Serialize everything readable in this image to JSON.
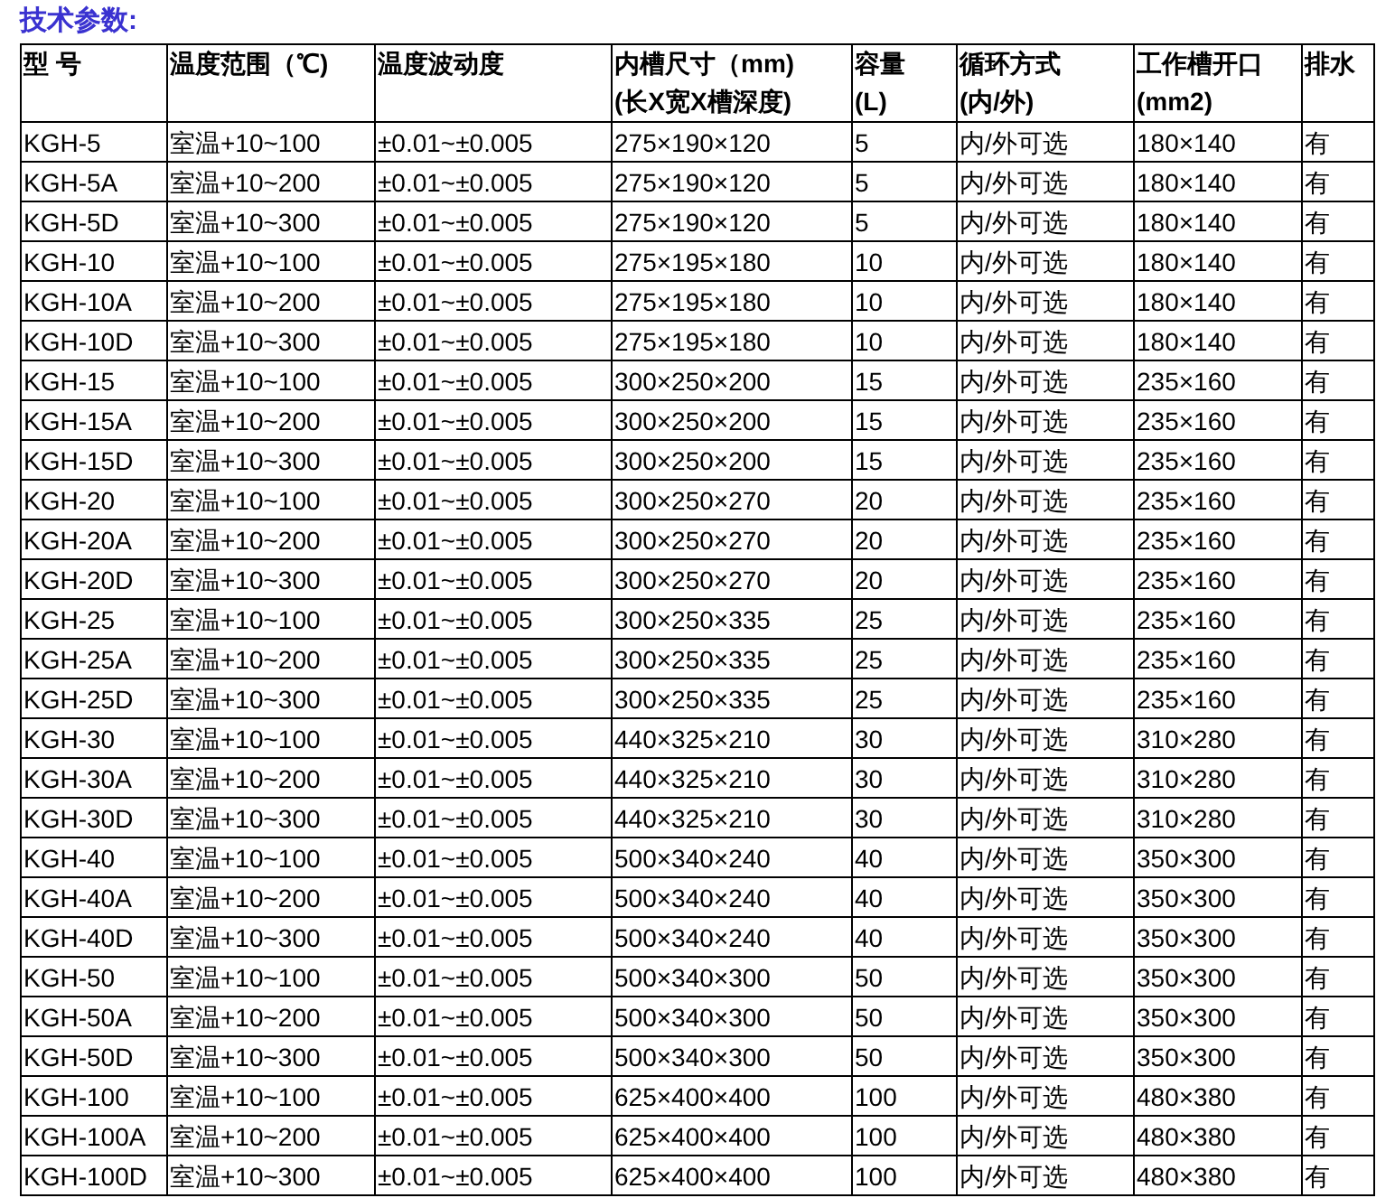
{
  "title": "技术参数:",
  "table": {
    "columns": [
      "型 号",
      "温度范围（℃)",
      "温度波动度",
      "内槽尺寸（mm)\n(长X宽X槽深度)",
      "容量\n(L)",
      "循环方式\n(内/外)",
      "工作槽开口\n(mm2)",
      "排水"
    ],
    "rows": [
      [
        "KGH-5",
        "室温+10~100",
        "±0.01~±0.005",
        "275×190×120",
        "5",
        "内/外可选",
        "180×140",
        "有"
      ],
      [
        "KGH-5A",
        "室温+10~200",
        "±0.01~±0.005",
        "275×190×120",
        "5",
        "内/外可选",
        "180×140",
        "有"
      ],
      [
        "KGH-5D",
        "室温+10~300",
        "±0.01~±0.005",
        "275×190×120",
        "5",
        "内/外可选",
        "180×140",
        "有"
      ],
      [
        "KGH-10",
        "室温+10~100",
        "±0.01~±0.005",
        "275×195×180",
        "10",
        "内/外可选",
        "180×140",
        "有"
      ],
      [
        "KGH-10A",
        "室温+10~200",
        "±0.01~±0.005",
        "275×195×180",
        "10",
        "内/外可选",
        "180×140",
        "有"
      ],
      [
        "KGH-10D",
        "室温+10~300",
        "±0.01~±0.005",
        "275×195×180",
        "10",
        "内/外可选",
        "180×140",
        "有"
      ],
      [
        "KGH-15",
        "室温+10~100",
        "±0.01~±0.005",
        "300×250×200",
        "15",
        "内/外可选",
        "235×160",
        "有"
      ],
      [
        "KGH-15A",
        "室温+10~200",
        "±0.01~±0.005",
        "300×250×200",
        "15",
        "内/外可选",
        "235×160",
        "有"
      ],
      [
        "KGH-15D",
        "室温+10~300",
        "±0.01~±0.005",
        "300×250×200",
        "15",
        "内/外可选",
        "235×160",
        "有"
      ],
      [
        "KGH-20",
        "室温+10~100",
        "±0.01~±0.005",
        "300×250×270",
        "20",
        "内/外可选",
        "235×160",
        "有"
      ],
      [
        "KGH-20A",
        "室温+10~200",
        "±0.01~±0.005",
        "300×250×270",
        "20",
        "内/外可选",
        "235×160",
        "有"
      ],
      [
        "KGH-20D",
        "室温+10~300",
        "±0.01~±0.005",
        "300×250×270",
        "20",
        "内/外可选",
        "235×160",
        "有"
      ],
      [
        "KGH-25",
        "室温+10~100",
        "±0.01~±0.005",
        "300×250×335",
        "25",
        "内/外可选",
        "235×160",
        "有"
      ],
      [
        "KGH-25A",
        "室温+10~200",
        "±0.01~±0.005",
        "300×250×335",
        "25",
        "内/外可选",
        "235×160",
        "有"
      ],
      [
        "KGH-25D",
        "室温+10~300",
        "±0.01~±0.005",
        "300×250×335",
        "25",
        "内/外可选",
        "235×160",
        "有"
      ],
      [
        "KGH-30",
        "室温+10~100",
        "±0.01~±0.005",
        "440×325×210",
        "30",
        "内/外可选",
        "310×280",
        "有"
      ],
      [
        "KGH-30A",
        "室温+10~200",
        "±0.01~±0.005",
        "440×325×210",
        "30",
        "内/外可选",
        "310×280",
        "有"
      ],
      [
        "KGH-30D",
        "室温+10~300",
        "±0.01~±0.005",
        "440×325×210",
        "30",
        "内/外可选",
        "310×280",
        "有"
      ],
      [
        "KGH-40",
        "室温+10~100",
        "±0.01~±0.005",
        "500×340×240",
        "40",
        "内/外可选",
        "350×300",
        "有"
      ],
      [
        "KGH-40A",
        "室温+10~200",
        "±0.01~±0.005",
        "500×340×240",
        "40",
        "内/外可选",
        "350×300",
        "有"
      ],
      [
        "KGH-40D",
        "室温+10~300",
        "±0.01~±0.005",
        "500×340×240",
        "40",
        "内/外可选",
        "350×300",
        "有"
      ],
      [
        "KGH-50",
        "室温+10~100",
        "±0.01~±0.005",
        "500×340×300",
        "50",
        "内/外可选",
        "350×300",
        "有"
      ],
      [
        "KGH-50A",
        "室温+10~200",
        "±0.01~±0.005",
        "500×340×300",
        "50",
        "内/外可选",
        "350×300",
        "有"
      ],
      [
        "KGH-50D",
        "室温+10~300",
        "±0.01~±0.005",
        "500×340×300",
        "50",
        "内/外可选",
        "350×300",
        "有"
      ],
      [
        "KGH-100",
        "室温+10~100",
        "±0.01~±0.005",
        "625×400×400",
        "100",
        "内/外可选",
        "480×380",
        "有"
      ],
      [
        "KGH-100A",
        "室温+10~200",
        "±0.01~±0.005",
        "625×400×400",
        "100",
        "内/外可选",
        "480×380",
        "有"
      ],
      [
        "KGH-100D",
        "室温+10~300",
        "±0.01~±0.005",
        "625×400×400",
        "100",
        "内/外可选",
        "480×380",
        "有"
      ]
    ]
  }
}
